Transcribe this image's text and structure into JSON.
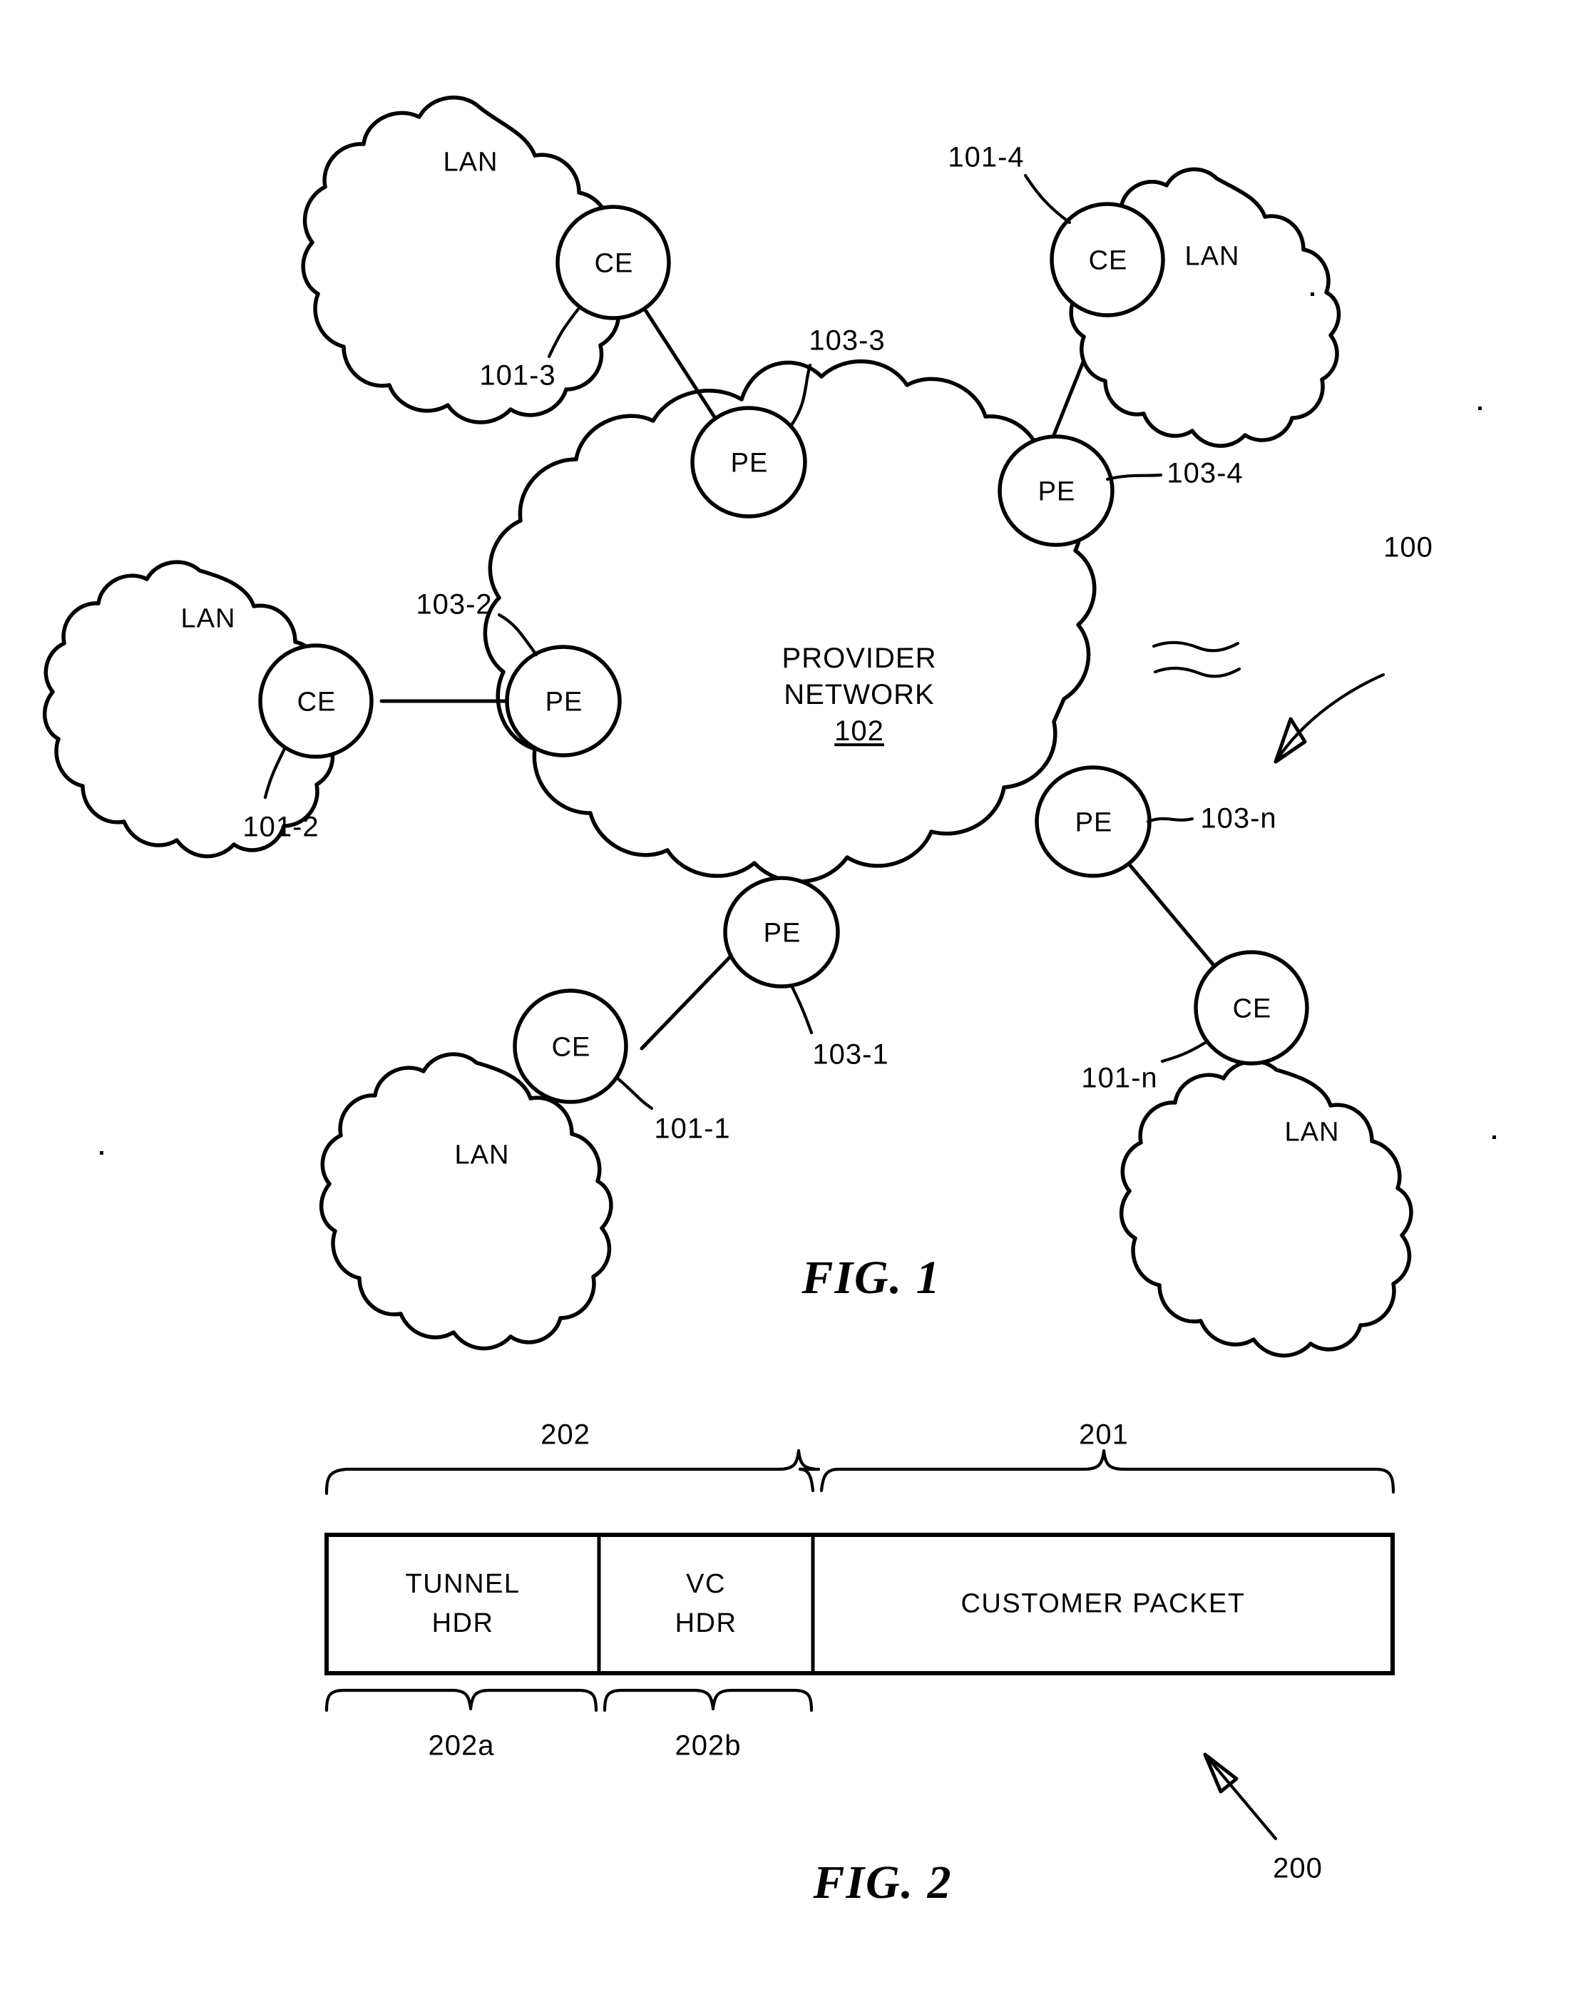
{
  "document": {
    "type": "patent-drawing-sheet",
    "figures": [
      "FIG. 1",
      "FIG. 2"
    ]
  },
  "figure1": {
    "caption": "FIG. 1",
    "system_ref": "100",
    "cloud": {
      "name": "provider-network",
      "line1": "PROVIDER",
      "line2": "NETWORK",
      "ref": "102"
    },
    "pe_nodes": [
      {
        "label": "PE",
        "ref": "103-3"
      },
      {
        "label": "PE",
        "ref": "103-4"
      },
      {
        "label": "PE",
        "ref": "103-2"
      },
      {
        "label": "PE",
        "ref": "103-n"
      },
      {
        "label": "PE",
        "ref": "103-1"
      }
    ],
    "ce_nodes": [
      {
        "label": "CE",
        "ref": "101-3"
      },
      {
        "label": "CE",
        "ref": "101-4"
      },
      {
        "label": "CE",
        "ref": "101-2"
      },
      {
        "label": "CE",
        "ref": "101-n"
      },
      {
        "label": "CE",
        "ref": "101-1"
      }
    ],
    "lan_clouds": [
      {
        "label": "LAN"
      },
      {
        "label": "LAN"
      },
      {
        "label": "LAN"
      },
      {
        "label": "LAN"
      },
      {
        "label": "LAN"
      }
    ]
  },
  "figure2": {
    "caption": "FIG. 2",
    "packet_ref": "200",
    "fields": [
      {
        "line1": "TUNNEL",
        "line2": "HDR",
        "ref": "202a"
      },
      {
        "line1": "VC",
        "line2": "HDR",
        "ref": "202b"
      },
      {
        "line1": "CUSTOMER PACKET",
        "line2": "",
        "ref": "201"
      }
    ],
    "braces": {
      "header_group_ref": "202",
      "payload_ref": "201",
      "tunnel_ref": "202a",
      "vc_ref": "202b"
    }
  },
  "colors": {
    "ink": "#000000",
    "paper": "#ffffff"
  }
}
